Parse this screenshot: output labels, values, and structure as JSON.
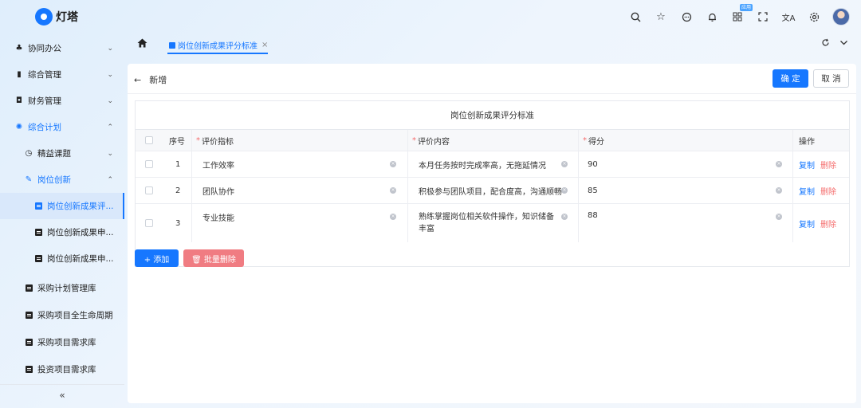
{
  "app": {
    "logo_text": "灯塔",
    "logo_icon": "lighthouse-logo-icon"
  },
  "topbar": {
    "icons": [
      "search-icon",
      "star-icon",
      "message-icon",
      "bell-icon",
      "apps-icon",
      "fullscreen-icon",
      "translate-icon",
      "settings-icon",
      "avatar"
    ],
    "apps_badge": "应用"
  },
  "sidebar": {
    "items": [
      {
        "label": "协同办公",
        "icon": "team-icon"
      },
      {
        "label": "综合管理",
        "icon": "bookmark-icon"
      },
      {
        "label": "财务管理",
        "icon": "wallet-icon"
      },
      {
        "label": "综合计划",
        "icon": "plan-icon"
      },
      {
        "label": "精益课题",
        "icon": "clock-icon"
      },
      {
        "label": "岗位创新",
        "icon": "edit-icon"
      },
      {
        "label": "岗位创新成果评...",
        "icon": "doc-icon"
      },
      {
        "label": "岗位创新成果申...",
        "icon": "doc-icon"
      },
      {
        "label": "岗位创新成果申...",
        "icon": "doc-icon"
      },
      {
        "label": "采购计划管理库",
        "icon": "doc-icon"
      },
      {
        "label": "采购项目全生命周期",
        "icon": "doc-icon"
      },
      {
        "label": "采购项目需求库",
        "icon": "doc-icon"
      },
      {
        "label": "投资项目需求库",
        "icon": "doc-icon"
      }
    ],
    "collapse_label": "«"
  },
  "tabs": {
    "active_label": "岗位创新成果评分标准",
    "close": "×"
  },
  "page": {
    "back_label": "新增",
    "confirm_label": "确 定",
    "cancel_label": "取 消"
  },
  "table": {
    "title": "岗位创新成果评分标准",
    "headers": {
      "index": "序号",
      "criterion": "评价指标",
      "content": "评价内容",
      "score": "得分",
      "ops": "操作"
    },
    "required_mark": "*",
    "rows": [
      {
        "index": "1",
        "criterion": "工作效率",
        "content": "本月任务按时完成率高，无拖延情况",
        "score": "90"
      },
      {
        "index": "2",
        "criterion": "团队协作",
        "content": "积极参与团队项目，配合度高，沟通顺畅",
        "score": "85"
      },
      {
        "index": "3",
        "criterion": "专业技能",
        "content": "熟练掌握岗位相关软件操作，知识储备丰富",
        "score": "88"
      }
    ],
    "copy_label": "复制",
    "delete_label": "删除"
  },
  "footer_buttons": {
    "add_label": "+ 添加",
    "batch_delete_label": "🗑 批量删除"
  }
}
